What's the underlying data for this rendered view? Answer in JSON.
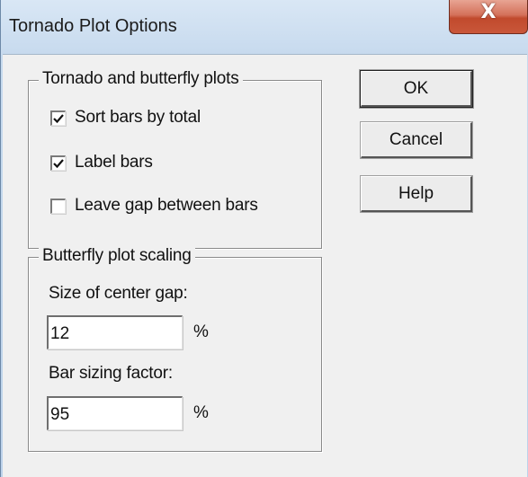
{
  "window": {
    "title": "Tornado Plot Options",
    "close_glyph": "X"
  },
  "tornado_group": {
    "title": "Tornado and butterfly plots",
    "options": [
      {
        "label": "Sort bars by total",
        "checked": true
      },
      {
        "label": "Label bars",
        "checked": true
      },
      {
        "label": "Leave gap between bars",
        "checked": false
      }
    ]
  },
  "butterfly_group": {
    "title": "Butterfly plot scaling",
    "center_gap_label": "Size of center gap:",
    "center_gap_value": "12",
    "center_gap_unit": "%",
    "bar_factor_label": "Bar sizing factor:",
    "bar_factor_value": "95",
    "bar_factor_unit": "%"
  },
  "buttons": {
    "ok": "OK",
    "cancel": "Cancel",
    "help": "Help"
  },
  "colors": {
    "title_bar": "#c7daee",
    "close_button": "#c9573a",
    "dialog_face": "#f0f0f0"
  },
  "icons": {
    "close": "close-icon",
    "check": "check-icon"
  }
}
